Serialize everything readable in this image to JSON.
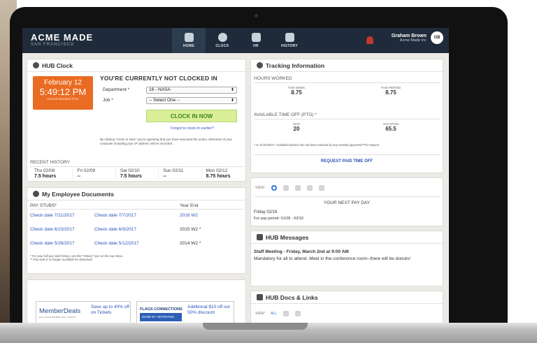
{
  "app": {
    "brand": "ACME MADE",
    "brand_sub": "SAN FRANCISCO",
    "nav": [
      {
        "label": "HOME",
        "icon": "home-icon"
      },
      {
        "label": "CLOCK",
        "icon": "clock-icon"
      },
      {
        "label": "HR",
        "icon": "people-icon"
      },
      {
        "label": "HISTORY",
        "icon": "history-icon"
      }
    ],
    "user_name": "Graham Brown",
    "user_company": "Acme Made Inc",
    "user_initials": "GB"
  },
  "clock": {
    "title": "HUB Clock",
    "date": "February 12",
    "time": "5:49:12 PM",
    "timezone": "Central Standard Time",
    "status": "YOU'RE CURRENTLY NOT CLOCKED IN",
    "department_label": "Department *",
    "department_value": "16 - NASA",
    "job_label": "Job *",
    "job_value": "-- Select One --",
    "clock_in_label": "CLOCK IN NOW",
    "forgot_label": "Forgot to clock in earlier?",
    "disclaimer": "By clicking \"Clock In Now\" you're agreeing that you have executed the action. Elements of your computer including your IP address will be recorded.",
    "recent_title": "RECENT HISTORY",
    "recent": [
      {
        "day": "Thu 02/08",
        "hours": "7.5 hours"
      },
      {
        "day": "Fri 02/09",
        "hours": "--"
      },
      {
        "day": "Sat 02/10",
        "hours": "7.5 hours"
      },
      {
        "day": "Sun 02/11",
        "hours": "--"
      },
      {
        "day": "Mon 02/12",
        "hours": "8.75 hours"
      }
    ]
  },
  "documents": {
    "title": "My Employee Documents",
    "pay_stubs_label": "PAY STUBS*",
    "year_end_label": "Year End",
    "stubs": [
      "Check date 7/21/2017",
      "Check date 7/7/2017",
      "Check date 6/23/2017",
      "Check date 6/9/2017",
      "Check date 5/26/2017",
      "Check date 5/12/2017"
    ],
    "year_end": [
      "2016 W2",
      "2015 W2 *",
      "2014 W2 *"
    ],
    "note1": "* For your full pay stub history, use the \"History\" icon on the top menu.",
    "note2": "** Pay stub is no longer available for download."
  },
  "promos": [
    {
      "brand": "MemberDeals",
      "brand_sub": "EXCLUSIVE MEMBER ONLY OFFERS",
      "text": "Save up to 40% off on Tickets"
    },
    {
      "brand": "FLAGS CONNECTIONS",
      "brand_sub": "MADE BY VETERANS",
      "text": "Additional $10 off our 50% discount"
    }
  ],
  "tracking": {
    "title": "Tracking Information",
    "hours_label": "HOURS WORKED",
    "this_week_label": "THIS WEEK",
    "this_week": "8.75",
    "this_period_label": "THIS PERIOD",
    "this_period": "8.75",
    "pto_label": "AVAILABLE TIME OFF (PTO) *",
    "sick_label": "SICK",
    "sick": "20",
    "vacation_label": "VACATION",
    "vacation": "65.5",
    "pto_note": "* As of 01/05/17. Available balance has not been reduced by any recently approved PTO request.",
    "request_label": "REQUEST PAID TIME OFF"
  },
  "payday": {
    "view_label": "VIEW:",
    "title": "YOUR NEXT PAY DAY",
    "date": "Friday 02/16",
    "period": "For pay period: 01/28 - 02/10"
  },
  "messages": {
    "title": "HUB Messages",
    "headline": "Staff Meeting - Friday, March 2nd at 9:00 AM",
    "body": "Mandatory for all to attend. Meet in the conference room--there will be donuts!"
  },
  "hubdocs": {
    "title": "HUB Docs & Links",
    "view_label": "VIEW:",
    "all_label": "ALL"
  },
  "colors": {
    "topbar": "#1f2b3a",
    "clock_orange": "#ea6b22",
    "clockin_green": "#d8ef98",
    "link_blue": "#2a54b8"
  }
}
